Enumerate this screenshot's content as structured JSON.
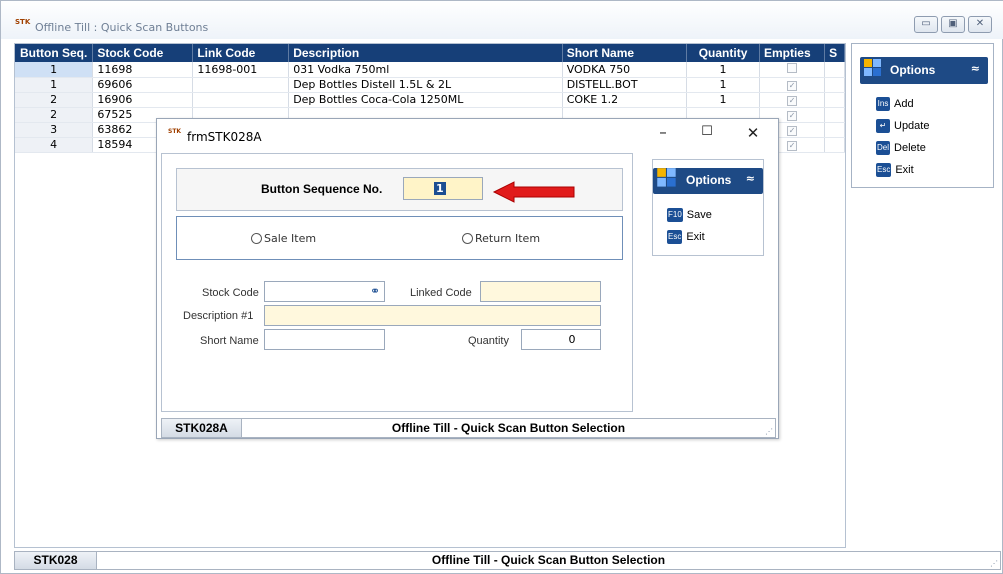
{
  "window": {
    "title": "Offline Till : Quick Scan Buttons",
    "app_icon_text": "STK"
  },
  "grid": {
    "columns": [
      "Button Seq.",
      "Stock Code",
      "Link Code",
      "Description",
      "Short Name",
      "Quantity",
      "Empties",
      "S"
    ],
    "rows": [
      {
        "seq": "1",
        "stock": "11698",
        "link": "11698-001",
        "desc": "031 Vodka 750ml",
        "short": "VODKA 750",
        "qty": "1",
        "empties": false
      },
      {
        "seq": "1",
        "stock": "69606",
        "link": "",
        "desc": "Dep Bottles Distell 1.5L & 2L",
        "short": "DISTELL.BOT",
        "qty": "1",
        "empties": true
      },
      {
        "seq": "2",
        "stock": "16906",
        "link": "",
        "desc": "Dep Bottles Coca-Cola 1250ML",
        "short": "COKE 1.2",
        "qty": "1",
        "empties": true
      },
      {
        "seq": "2",
        "stock": "67525",
        "link": "",
        "desc": "",
        "short": "",
        "qty": "",
        "empties": true
      },
      {
        "seq": "3",
        "stock": "63862",
        "link": "",
        "desc": "",
        "short": "",
        "qty": "",
        "empties": true
      },
      {
        "seq": "4",
        "stock": "18594",
        "link": "",
        "desc": "",
        "short": "",
        "qty": "",
        "empties": true
      }
    ]
  },
  "options_panel": {
    "title": "Options",
    "items": [
      {
        "key": "Ins",
        "label": "Add"
      },
      {
        "key": "↵",
        "label": "Update"
      },
      {
        "key": "Del",
        "label": "Delete"
      },
      {
        "key": "Esc",
        "label": "Exit"
      }
    ]
  },
  "status": {
    "code": "STK028",
    "text": "Offline Till - Quick Scan Button Selection"
  },
  "dialog": {
    "title": "frmSTK028A",
    "seq_label": "Button Sequence No.",
    "seq_value": "1",
    "radio_sale": "Sale Item",
    "radio_return": "Return Item",
    "stock_code_label": "Stock Code",
    "linked_code_label": "Linked Code",
    "desc_label": "Description #1",
    "short_name_label": "Short Name",
    "quantity_label": "Quantity",
    "quantity_value": "0",
    "options": {
      "title": "Options",
      "items": [
        {
          "key": "F10",
          "label": "Save"
        },
        {
          "key": "Esc",
          "label": "Exit"
        }
      ]
    },
    "status": {
      "code": "STK028A",
      "text": "Offline Till - Quick Scan Button Selection"
    }
  }
}
